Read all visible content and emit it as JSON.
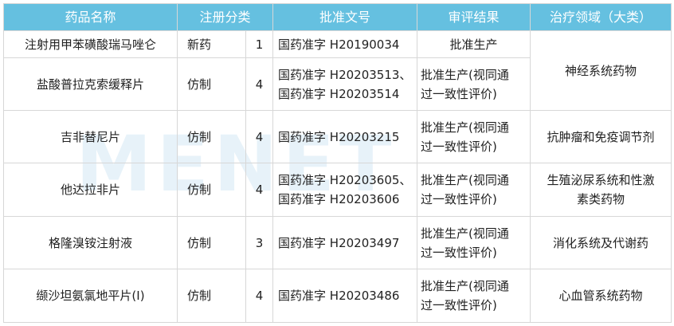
{
  "headers": [
    "药品名称",
    "注册分类",
    "批准文号",
    "审评结果",
    "治疗领域（大类）"
  ],
  "rows": [
    {
      "name": "注射用甲苯磺酸瑞马唑仑",
      "type": "新药",
      "cat": "1",
      "no": [
        "国药准字 H20190034"
      ],
      "result": [
        "批准生产"
      ],
      "area": [
        "神经系统药物"
      ]
    },
    {
      "name": "盐酸普拉克索缓释片",
      "type": "仿制",
      "cat": "4",
      "no": [
        "国药准字 H20203513、",
        "国药准字 H20203514"
      ],
      "result": [
        "批准生产(视同通",
        "过一致性评价)"
      ]
    },
    {
      "name": "吉非替尼片",
      "type": "仿制",
      "cat": "4",
      "no": [
        "国药准字 H20203215"
      ],
      "result": [
        "批准生产(视同通",
        "过一致性评价)"
      ],
      "area": [
        "抗肿瘤和免疫调节剂"
      ]
    },
    {
      "name": "他达拉非片",
      "type": "仿制",
      "cat": "4",
      "no": [
        "国药准字 H20203605、",
        "国药准字 H20203606"
      ],
      "result": [
        "批准生产(视同通",
        "过一致性评价)"
      ],
      "area": [
        "生殖泌尿系统和性激",
        "素类药物"
      ]
    },
    {
      "name": "格隆溴铵注射液",
      "type": "仿制",
      "cat": "3",
      "no": [
        "国药准字 H20203497"
      ],
      "result": [
        "批准生产(视同通",
        "过一致性评价)"
      ],
      "area": [
        "消化系统及代谢药"
      ]
    },
    {
      "name": "缬沙坦氨氯地平片(Ⅰ)",
      "type": "仿制",
      "cat": "4",
      "no": [
        "国药准字 H20203486"
      ],
      "result": [
        "批准生产(视同通",
        "过一致性评价)"
      ],
      "area": [
        "心血管系统药物"
      ]
    }
  ],
  "watermark": "MENET"
}
